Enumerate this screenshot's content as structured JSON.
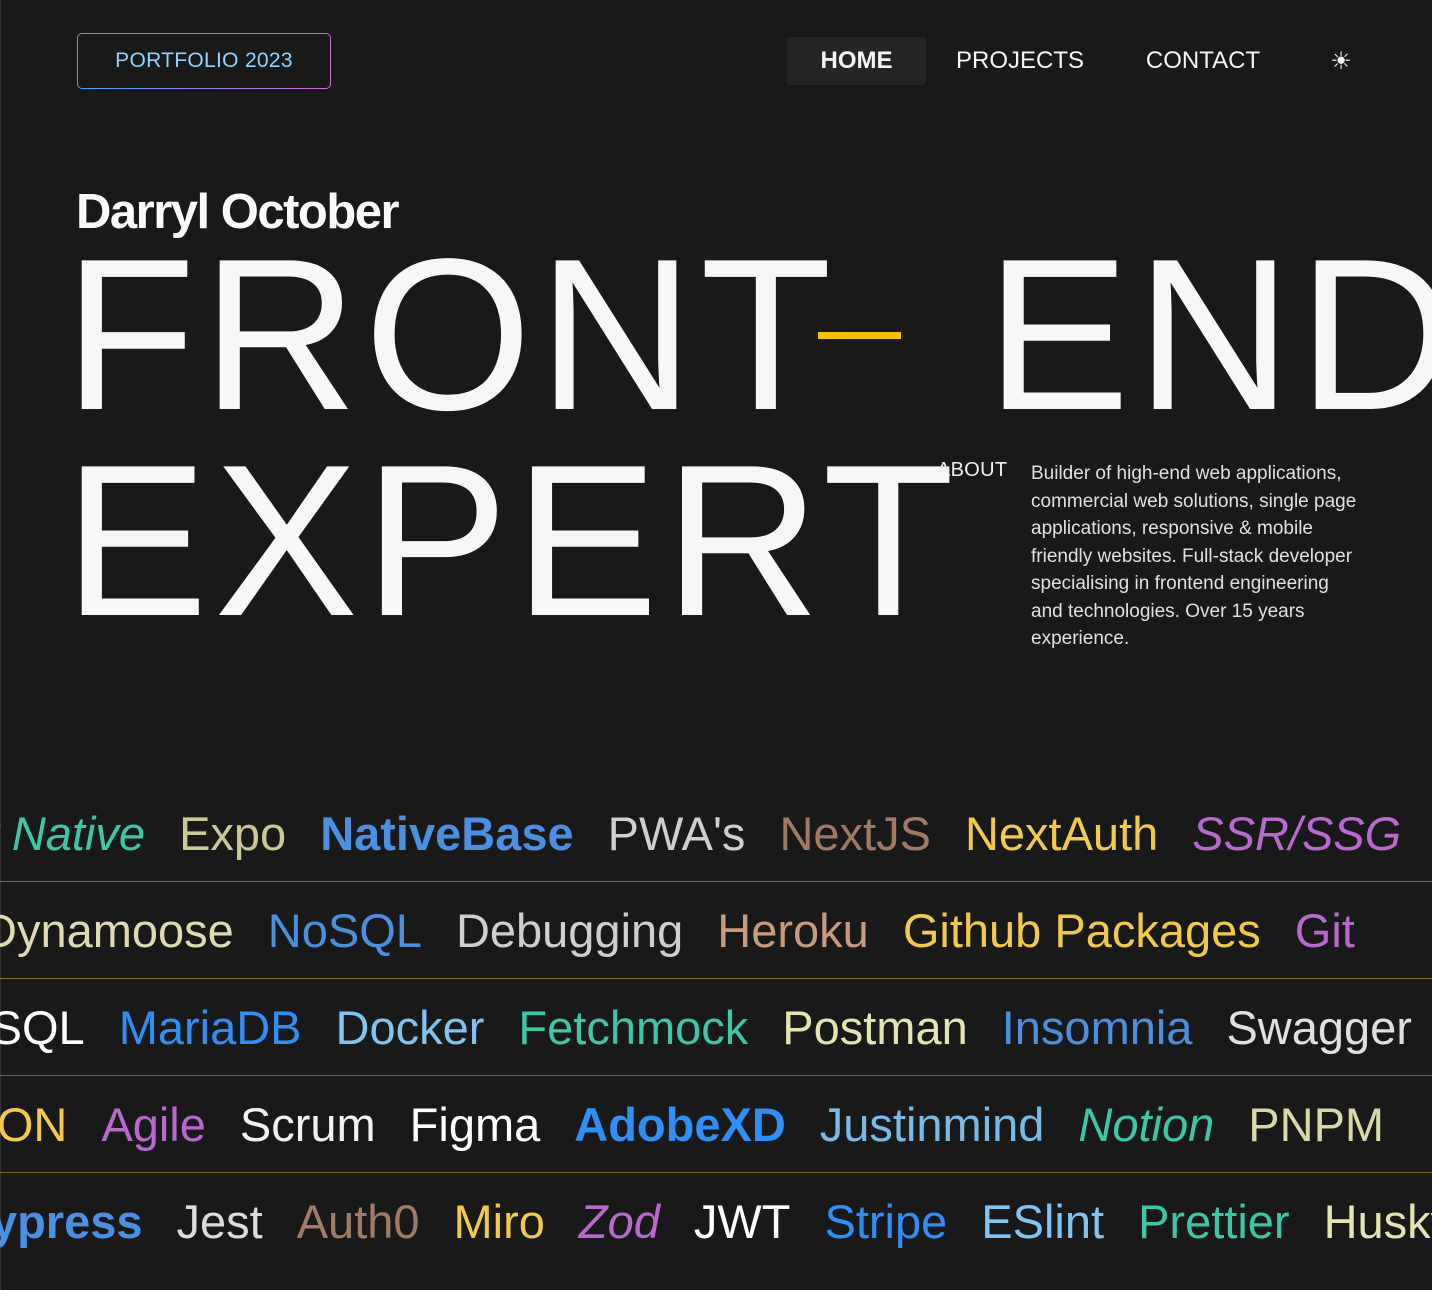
{
  "header": {
    "logo": "PORTFOLIO 2023",
    "nav": {
      "home": "HOME",
      "projects": "PROJECTS",
      "contact": "CONTACT"
    },
    "theme_icon": "☀"
  },
  "hero": {
    "name": "Darryl October",
    "line1a": "FRONT",
    "line1b": "END",
    "line2": "EXPERT",
    "dash_color": "#f2c200"
  },
  "about": {
    "label": "ABOUT",
    "text": "Builder of high-end web applications, commercial web solutions, single page applications, responsive & mobile friendly websites. Full-stack developer specialising in frontend engineering and technologies. Over 15 years experience."
  },
  "skills_rows": [
    [
      {
        "text": "React Native",
        "color": "#3dc7a6",
        "style": "italic"
      },
      {
        "text": "Expo",
        "color": "#d4d29a",
        "style": "light"
      },
      {
        "text": "NativeBase",
        "color": "#4a8fe0",
        "style": "bold"
      },
      {
        "text": "PWA's",
        "color": "#cfcfcf",
        "style": "normal"
      },
      {
        "text": "NextJS",
        "color": "#a9806a",
        "style": "light"
      },
      {
        "text": "NextAuth",
        "color": "#f2c94c",
        "style": "normal"
      },
      {
        "text": "SSR/SSG",
        "color": "#b968cf",
        "style": "italic"
      }
    ],
    [
      {
        "text": "Dynamoose",
        "color": "#dedbb2",
        "style": "normal"
      },
      {
        "text": "NoSQL",
        "color": "#4a8fe0",
        "style": "normal"
      },
      {
        "text": "Debugging",
        "color": "#cfcfcf",
        "style": "normal"
      },
      {
        "text": "Heroku",
        "color": "#c99a7e",
        "style": "normal"
      },
      {
        "text": "Github Packages",
        "color": "#f2c94c",
        "style": "normal"
      },
      {
        "text": "Git",
        "color": "#b968cf",
        "style": "normal"
      }
    ],
    [
      {
        "text": "MySQL",
        "color": "#ffffff",
        "style": "normal"
      },
      {
        "text": "MariaDB",
        "color": "#2f8ff7",
        "style": "normal"
      },
      {
        "text": "Docker",
        "color": "#7fc4f2",
        "style": "normal"
      },
      {
        "text": "Fetchmock",
        "color": "#3dc7a6",
        "style": "normal"
      },
      {
        "text": "Postman",
        "color": "#e4e4b0",
        "style": "normal"
      },
      {
        "text": "Insomnia",
        "color": "#4a8fe0",
        "style": "normal"
      },
      {
        "text": "Swagger",
        "color": "#e0e0e0",
        "style": "normal"
      }
    ],
    [
      {
        "text": "JSON",
        "color": "#f2c94c",
        "style": "normal"
      },
      {
        "text": "Agile",
        "color": "#b968cf",
        "style": "normal"
      },
      {
        "text": "Scrum",
        "color": "#f2f2f2",
        "style": "normal"
      },
      {
        "text": "Figma",
        "color": "#ffffff",
        "style": "normal"
      },
      {
        "text": "AdobeXD",
        "color": "#2f8ff7",
        "style": "bold"
      },
      {
        "text": "Justinmind",
        "color": "#7fc4f2",
        "style": "light"
      },
      {
        "text": "Notion",
        "color": "#3dc7a6",
        "style": "italic"
      },
      {
        "text": "PNPM",
        "color": "#e4e4b0",
        "style": "light"
      }
    ],
    [
      {
        "text": "Cypress",
        "color": "#4a8fe0",
        "style": "bold"
      },
      {
        "text": "Jest",
        "color": "#dcdcdc",
        "style": "normal"
      },
      {
        "text": "Auth0",
        "color": "#a9806a",
        "style": "light"
      },
      {
        "text": "Miro",
        "color": "#f2c94c",
        "style": "normal"
      },
      {
        "text": "Zod",
        "color": "#b968cf",
        "style": "italic"
      },
      {
        "text": "JWT",
        "color": "#ffffff",
        "style": "normal"
      },
      {
        "text": "Stripe",
        "color": "#2f8ff7",
        "style": "normal"
      },
      {
        "text": "ESlint",
        "color": "#7fc4f2",
        "style": "normal"
      },
      {
        "text": "Prettier",
        "color": "#3dc7a6",
        "style": "normal"
      },
      {
        "text": "Husky",
        "color": "#e4e4b0",
        "style": "normal"
      }
    ]
  ]
}
